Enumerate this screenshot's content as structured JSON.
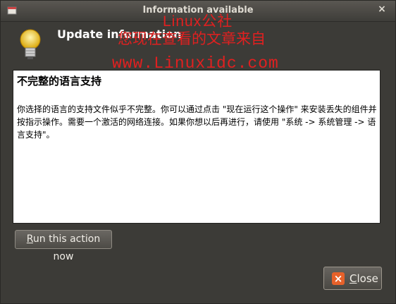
{
  "window": {
    "title": "Information available",
    "close_glyph": "×"
  },
  "header": {
    "title": "Update information",
    "icon": "lightbulb-icon"
  },
  "watermark": {
    "line1": "Linux公社",
    "line2": "您现在查看的文章来自",
    "line3": "www.Linuxidc.com"
  },
  "panel": {
    "title": "不完整的语言支持",
    "body": "你选择的语言的支持文件似乎不完整。你可以通过点击 \"现在运行这个操作\" 来安装丢失的组件并按指示操作。需要一个激活的网络连接。如果你想以后再进行，请使用 \"系统 -> 系统管理 -> 语言支持\"。"
  },
  "buttons": {
    "run_first": "R",
    "run_rest": "un this action now",
    "close_first": "C",
    "close_rest": "lose",
    "close_icon": "×"
  },
  "colors": {
    "window_bg": "#3c3b37",
    "accent_orange": "#e6612a",
    "watermark_red": "#e02020"
  }
}
